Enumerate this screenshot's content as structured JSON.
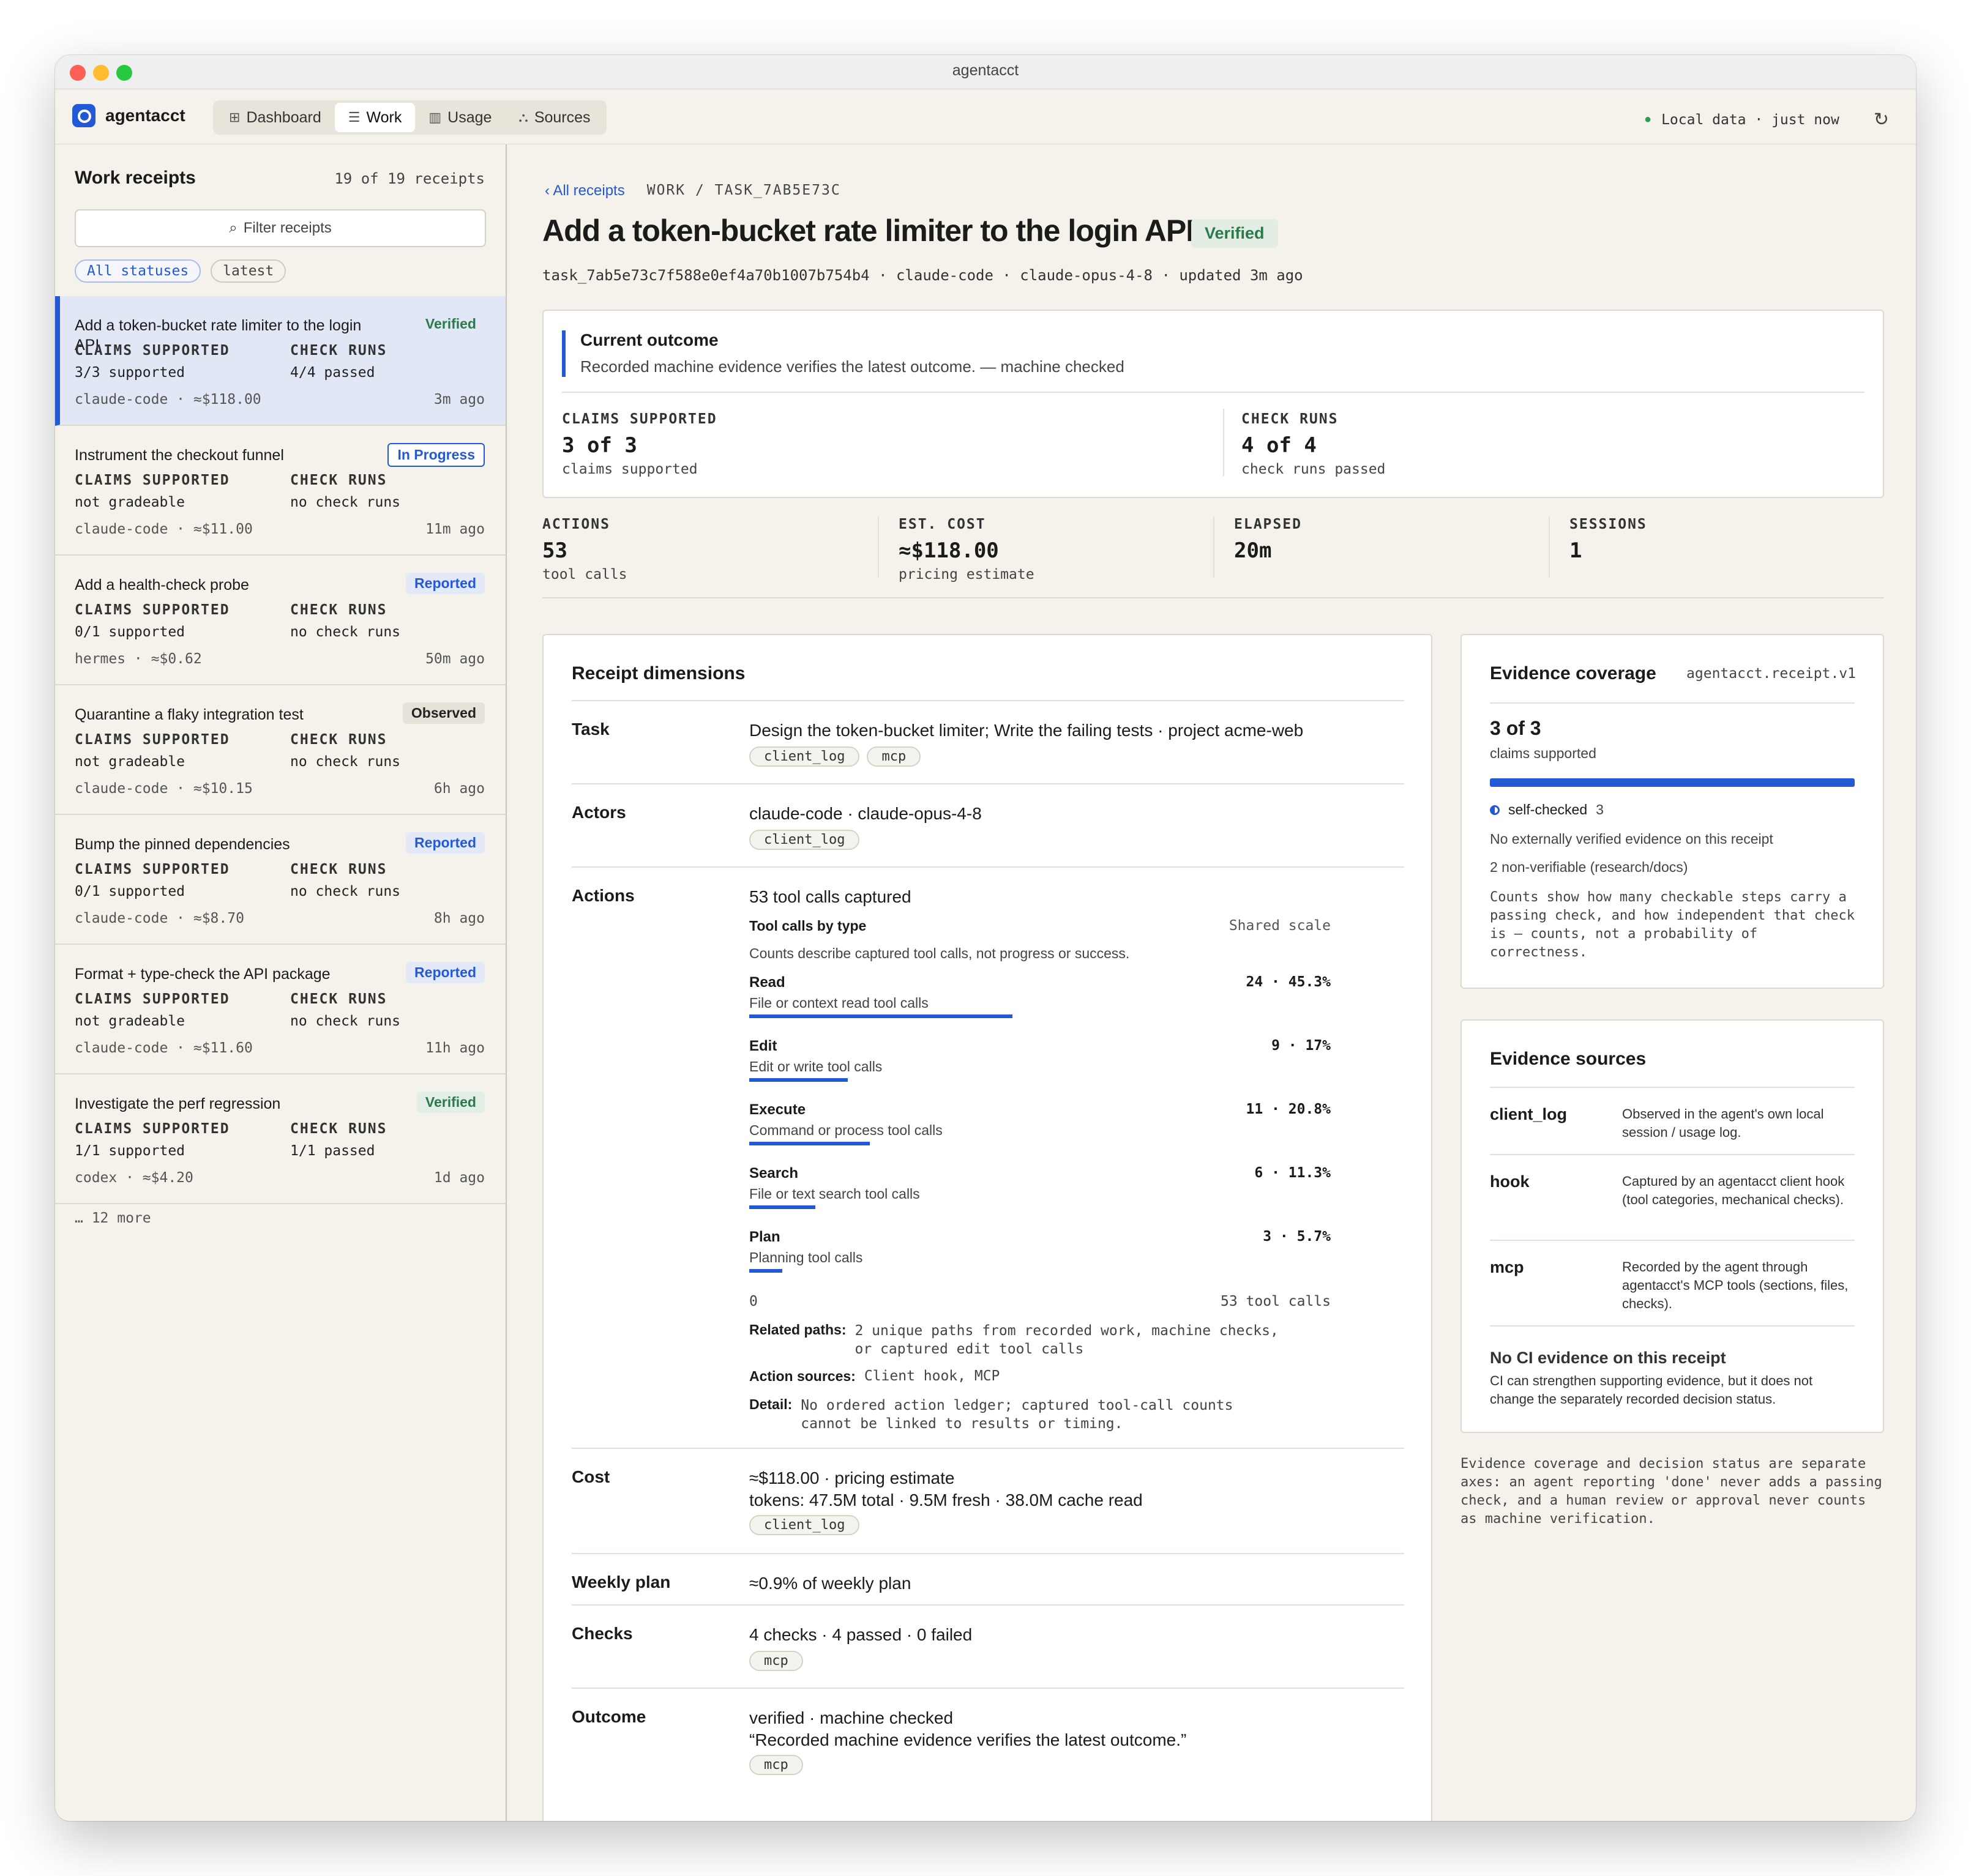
{
  "window": {
    "title": "agentacct"
  },
  "app": {
    "brand": "agentacct",
    "nav": [
      {
        "label": "Dashboard",
        "icon": "grid-icon"
      },
      {
        "label": "Work",
        "icon": "list-icon",
        "active": true
      },
      {
        "label": "Usage",
        "icon": "bar-chart-icon"
      },
      {
        "label": "Sources",
        "icon": "nodes-icon"
      }
    ],
    "status": "Local data · just now"
  },
  "sidebar": {
    "title": "Work receipts",
    "count": "19 of 19 receipts",
    "filter_placeholder": "Filter receipts",
    "chips": [
      "All statuses",
      "latest"
    ],
    "labels": {
      "claims": "CLAIMS SUPPORTED",
      "checks": "CHECK RUNS"
    },
    "items": [
      {
        "title": "Add a token-bucket rate limiter to the login API",
        "badge": "Verified",
        "claims": "3/3 supported",
        "checks": "4/4 passed",
        "meta": "claude-code · ≈$118.00",
        "ago": "3m ago"
      },
      {
        "title": "Instrument the checkout funnel",
        "badge": "In Progress",
        "claims": "not gradeable",
        "checks": "no check runs",
        "meta": "claude-code · ≈$11.00",
        "ago": "11m ago"
      },
      {
        "title": "Add a health-check probe",
        "badge": "Reported",
        "claims": "0/1 supported",
        "checks": "no check runs",
        "meta": "hermes · ≈$0.62",
        "ago": "50m ago"
      },
      {
        "title": "Quarantine a flaky integration test",
        "badge": "Observed",
        "claims": "not gradeable",
        "checks": "no check runs",
        "meta": "claude-code · ≈$10.15",
        "ago": "6h ago"
      },
      {
        "title": "Bump the pinned dependencies",
        "badge": "Reported",
        "claims": "0/1 supported",
        "checks": "no check runs",
        "meta": "claude-code · ≈$8.70",
        "ago": "8h ago"
      },
      {
        "title": "Format + type-check the API package",
        "badge": "Reported",
        "claims": "not gradeable",
        "checks": "no check runs",
        "meta": "claude-code · ≈$11.60",
        "ago": "11h ago"
      },
      {
        "title": "Investigate the perf regression",
        "badge": "Verified",
        "claims": "1/1 supported",
        "checks": "1/1 passed",
        "meta": "codex · ≈$4.20",
        "ago": "1d ago"
      }
    ],
    "more": "… 12 more"
  },
  "detail": {
    "back": "All receipts",
    "path": "WORK / TASK_7AB5E73C",
    "title": "Add a token-bucket rate limiter to the login API",
    "badge": "Verified",
    "meta": "task_7ab5e73c7f588e0ef4a70b1007b754b4 · claude-code · claude-opus-4-8 · updated 3m ago",
    "outcome": {
      "title": "Current outcome",
      "subtitle": "Recorded machine evidence verifies the latest outcome. — machine checked",
      "claims_label": "CLAIMS SUPPORTED",
      "claims_value": "3 of 3",
      "claims_sub": "claims supported",
      "checks_label": "CHECK RUNS",
      "checks_value": "4 of 4",
      "checks_sub": "check runs passed"
    },
    "stats": [
      {
        "label": "ACTIONS",
        "value": "53",
        "sub": "tool calls"
      },
      {
        "label": "EST. COST",
        "value": "≈$118.00",
        "sub": "pricing estimate"
      },
      {
        "label": "ELAPSED",
        "value": "20m",
        "sub": ""
      },
      {
        "label": "SESSIONS",
        "value": "1",
        "sub": ""
      }
    ]
  },
  "dimensions": {
    "title": "Receipt dimensions",
    "task": {
      "label": "Task",
      "value": "Design the token-bucket limiter; Write the failing tests · project acme-web",
      "tags": [
        "client_log",
        "mcp"
      ]
    },
    "actors": {
      "label": "Actors",
      "value": "claude-code · claude-opus-4-8",
      "tags": [
        "client_log"
      ]
    },
    "actions": {
      "label": "Actions",
      "value": "53 tool calls captured",
      "chart_title": "Tool calls by type",
      "scale": "Shared scale",
      "note": "Counts describe captured tool calls, not progress or success.",
      "axis_min": "0",
      "axis_max": "53 tool calls",
      "related_label": "Related paths:",
      "related_value": "2 unique paths from recorded work, machine checks,",
      "related_value2": "or captured edit tool calls",
      "sources_label": "Action sources:",
      "sources_value": "Client hook, MCP",
      "detail_label": "Detail:",
      "detail_value": "No ordered action ledger; captured tool-call counts",
      "detail_value2": "cannot be linked to results or timing."
    },
    "cost": {
      "label": "Cost",
      "line1": "≈$118.00 · pricing estimate",
      "line2": "tokens: 47.5M total · 9.5M fresh · 38.0M cache read",
      "tags": [
        "client_log"
      ]
    },
    "weekly": {
      "label": "Weekly plan",
      "value": "≈0.9% of weekly plan"
    },
    "checks": {
      "label": "Checks",
      "value": "4 checks · 4 passed · 0 failed",
      "tags": [
        "mcp"
      ]
    },
    "outcome": {
      "label": "Outcome",
      "line1": "verified · machine checked",
      "line2": "“Recorded machine evidence verifies the latest outcome.”",
      "tags": [
        "mcp"
      ]
    }
  },
  "chart_data": {
    "type": "bar",
    "title": "Tool calls by type",
    "categories": [
      "Read",
      "Edit",
      "Execute",
      "Search",
      "Plan"
    ],
    "descriptions": [
      "File or context read tool calls",
      "Edit or write tool calls",
      "Command or process tool calls",
      "File or text search tool calls",
      "Planning tool calls"
    ],
    "values": [
      24,
      9,
      11,
      6,
      3
    ],
    "value_labels": [
      "24 · 45.3%",
      "9 · 17%",
      "11 · 20.8%",
      "6 · 11.3%",
      "3 · 5.7%"
    ],
    "xlim": [
      0,
      53
    ],
    "color": "#2459d6"
  },
  "coverage": {
    "title": "Evidence coverage",
    "version": "agentacct.receipt.v1",
    "value": "3 of 3",
    "sub": "claims supported",
    "fraction": 1.0,
    "legend_label": "self-checked",
    "legend_count": "3",
    "line1": "No externally verified evidence on this receipt",
    "line2": "2 non-verifiable (research/docs)",
    "explain": "Counts show how many checkable steps carry a passing check, and how independent that check is — counts, not a probability of correctness."
  },
  "sources": {
    "title": "Evidence sources",
    "rows": [
      {
        "key": "client_log",
        "desc": "Observed in the agent's own local session / usage log."
      },
      {
        "key": "hook",
        "desc": "Captured by an agentacct client hook (tool categories, mechanical checks)."
      },
      {
        "key": "mcp",
        "desc": "Recorded by the agent through agentacct's MCP tools (sections, files, checks)."
      }
    ],
    "noci_title": "No CI evidence on this receipt",
    "noci_body": "CI can strengthen supporting evidence, but it does not change the separately recorded decision status."
  },
  "footnote": "Evidence coverage and decision status are separate axes: an agent reporting 'done' never adds a passing check, and a human review or approval never counts as machine verification."
}
